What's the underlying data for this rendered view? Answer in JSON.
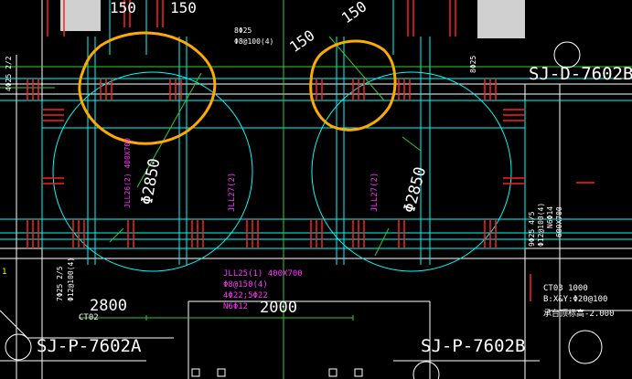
{
  "drawing": {
    "dims": {
      "top_150_a": "150",
      "top_150_b": "150",
      "top_150_c": "150",
      "top_150_d": "150",
      "dim_2800": "2800",
      "dim_2000": "2000",
      "dia_left": "Φ2850",
      "dia_right": "Φ2850"
    },
    "labels": {
      "sj_d_7602b": "SJ-D-7602B",
      "sj_p_7602a": "SJ-P-7602A",
      "sj_p_7602b": "SJ-P-7602B"
    },
    "beam_notes": {
      "top_rebar_1": "8Φ25",
      "top_rebar_2": "Φ8@100(4)",
      "right_rebar": "8Φ25",
      "left_vert_rebar": "4Φ25 2/2",
      "jll25_line1": "JLL25(1) 400X700",
      "jll25_line2": "Φ8@150(4)",
      "jll25_line3": "4Φ22;5Φ22",
      "jll25_line4": "N6Φ12",
      "jll27_left": "JLL27(2)",
      "jll27_right": "JLL27(2)",
      "jll26": "JLL26(2) 400X700",
      "left_beam_1": "7Φ25 2/5",
      "left_beam_2": "Φ12@100(4)",
      "right_beam_1": "9Φ25 4/5",
      "right_beam_2": "Φ12@100(4)",
      "right_beam_3": "N6Φ14",
      "right_beam_4": "600X700",
      "ct_left": "CT02",
      "ct_right_1": "CT03 1000",
      "ct_right_2": "B:X&Y:Φ20@100",
      "ct_right_3": "承台顶标高-2.000",
      "misc_left": "1"
    }
  }
}
